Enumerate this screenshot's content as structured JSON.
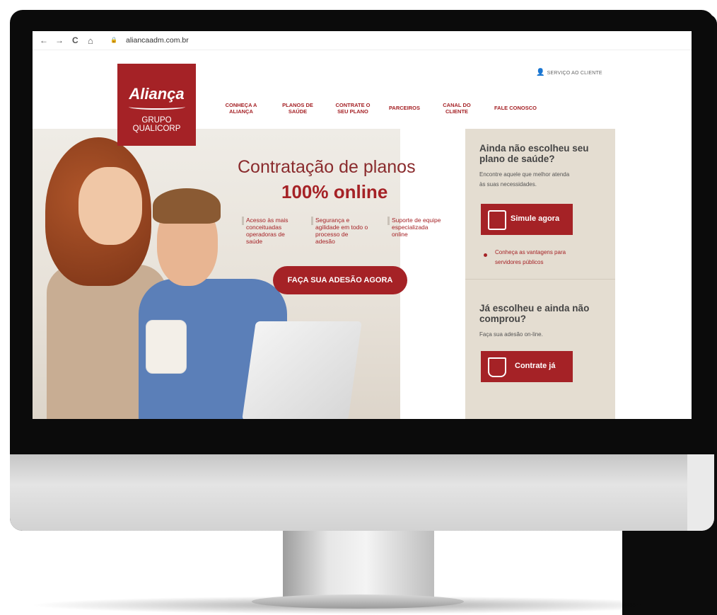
{
  "browser": {
    "back_label": "←",
    "forward_label": "→",
    "reload_label": "C",
    "home_label": "⌂",
    "lock_label": "🔒",
    "url": "aliancaadm.com.br"
  },
  "logo": {
    "brand": "Aliança",
    "subtitle": "GRUPO QUALICORP"
  },
  "header": {
    "service_label": "SERVIÇO AO CLIENTE",
    "menu": [
      {
        "label": "CONHEÇA A ALIANÇA"
      },
      {
        "label": "PLANOS DE SAÚDE"
      },
      {
        "label": "CONTRATE O SEU PLANO"
      },
      {
        "label": "PARCEIROS"
      },
      {
        "label": "CANAL DO CLIENTE"
      },
      {
        "label": "FALE CONOSCO"
      }
    ]
  },
  "hero": {
    "headline_line1": "Contratação de planos",
    "headline_line2": "100% online",
    "features": [
      {
        "text": "Acesso às mais conceituadas operadoras de saúde"
      },
      {
        "text": "Segurança e agilidade em todo o processo de adesão"
      },
      {
        "text": "Suporte de equipe especializada online"
      }
    ],
    "cta_label": "FAÇA SUA ADESÃO AGORA"
  },
  "sidebar": {
    "block1_title": "Ainda não escolheu seu plano de saúde?",
    "block1_text": "Encontre aquele que melhor atenda às suas necessidades.",
    "simulate_label": "Simule agora",
    "link_text": "Conheça as vantagens para servidores públicos",
    "block2_title": "Já escolheu e ainda não comprou?",
    "block2_text": "Faça sua adesão on-line.",
    "contract_label": "Contrate já"
  },
  "colors": {
    "brand_red": "#a52226",
    "sidebar_bg": "#e4ddd1",
    "monitor_frame": "#0b0b0b"
  }
}
